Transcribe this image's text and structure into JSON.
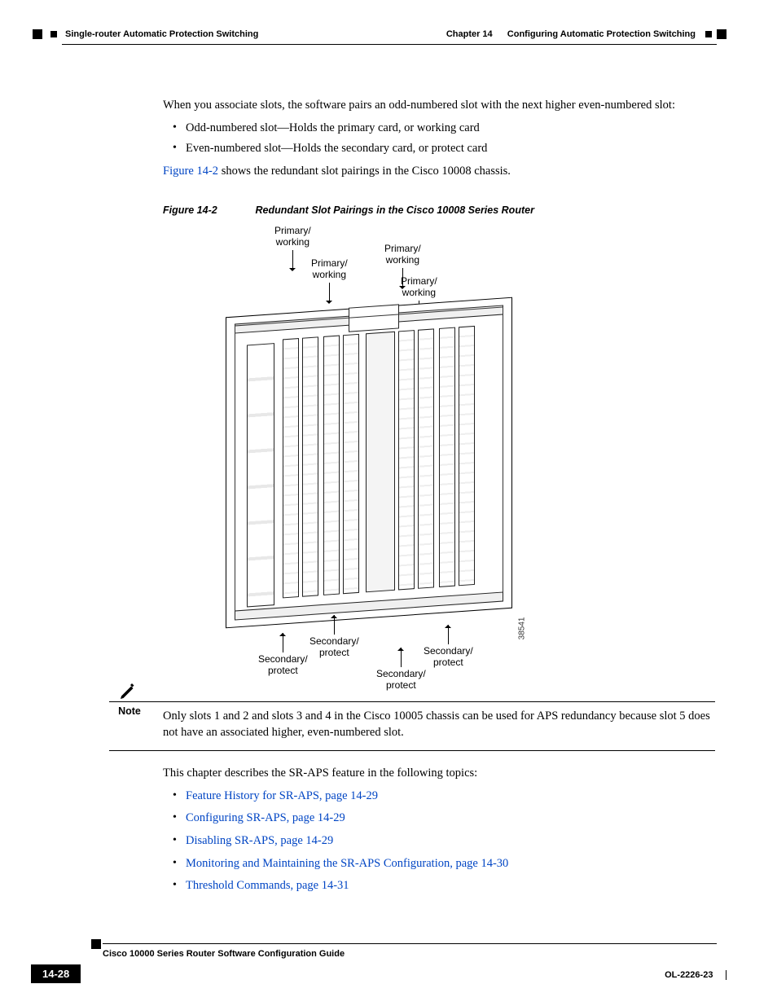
{
  "header": {
    "section_left": "Single-router Automatic Protection Switching",
    "chapter_label": "Chapter 14",
    "chapter_title": "Configuring Automatic Protection Switching"
  },
  "body": {
    "intro": "When you associate slots, the software pairs an odd-numbered slot with the next higher even-numbered slot:",
    "bullet1": "Odd-numbered slot—Holds the primary card, or working card",
    "bullet2": "Even-numbered slot—Holds the secondary card, or protect card",
    "figref_link": "Figure 14-2",
    "figref_tail": " shows the redundant slot pairings in the Cisco 10008 chassis."
  },
  "figure": {
    "number": "Figure 14-2",
    "caption": "Redundant Slot Pairings in the Cisco 10008 Series Router",
    "labels_top": [
      "Primary/",
      "working"
    ],
    "labels_bottom": [
      "Secondary/",
      "protect"
    ],
    "id_number": "38541"
  },
  "note": {
    "label": "Note",
    "text": "Only slots 1 and 2 and slots 3 and 4 in the Cisco 10005 chassis can be used for APS redundancy because slot 5 does not have an associated higher, even-numbered slot."
  },
  "topics": {
    "intro": "This chapter describes the SR-APS feature in the following topics:",
    "items": [
      "Feature History for SR-APS, page 14-29",
      "Configuring SR-APS, page 14-29",
      "Disabling SR-APS, page 14-29",
      "Monitoring and Maintaining the SR-APS Configuration, page 14-30",
      "Threshold Commands, page 14-31"
    ]
  },
  "footer": {
    "guide_title": "Cisco 10000 Series Router Software Configuration Guide",
    "page_number": "14-28",
    "doc_id": "OL-2226-23"
  }
}
